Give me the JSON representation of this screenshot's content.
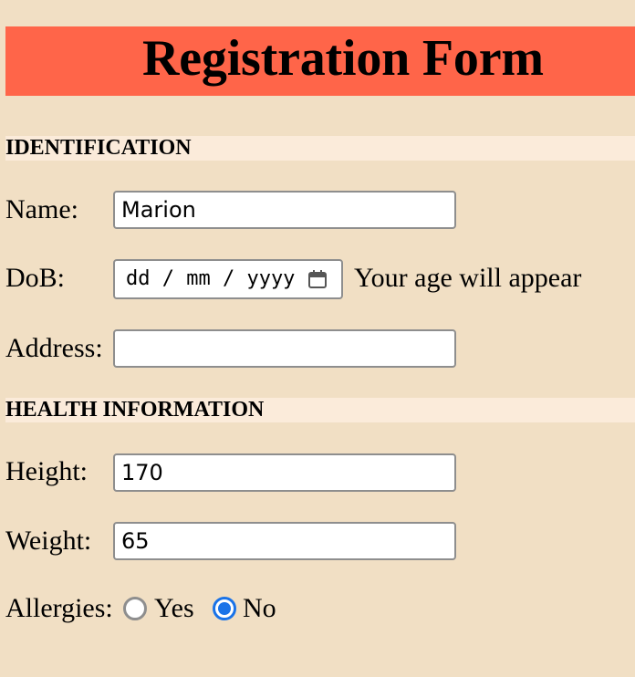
{
  "header": {
    "title": "Registration Form"
  },
  "sections": {
    "identification": "IDENTIFICATION",
    "health": "HEALTH INFORMATION"
  },
  "fields": {
    "name": {
      "label": "Name:",
      "value": "Marion"
    },
    "dob": {
      "label": "DoB:",
      "placeholder": "dd / mm / yyyy",
      "age_hint": "Your age will appear"
    },
    "address": {
      "label": "Address:",
      "value": ""
    },
    "height": {
      "label": "Height:",
      "value": "170"
    },
    "weight": {
      "label": "Weight:",
      "value": "65"
    },
    "allergies": {
      "label": "Allergies:",
      "options": [
        "Yes",
        "No"
      ],
      "selected": "No"
    }
  },
  "colors": {
    "background": "#f1dfc4",
    "banner": "#ff6549",
    "section_bar": "#fbebda",
    "radio_selected": "#1a73e8"
  },
  "icons": {
    "dob_picker": "calendar-icon"
  }
}
